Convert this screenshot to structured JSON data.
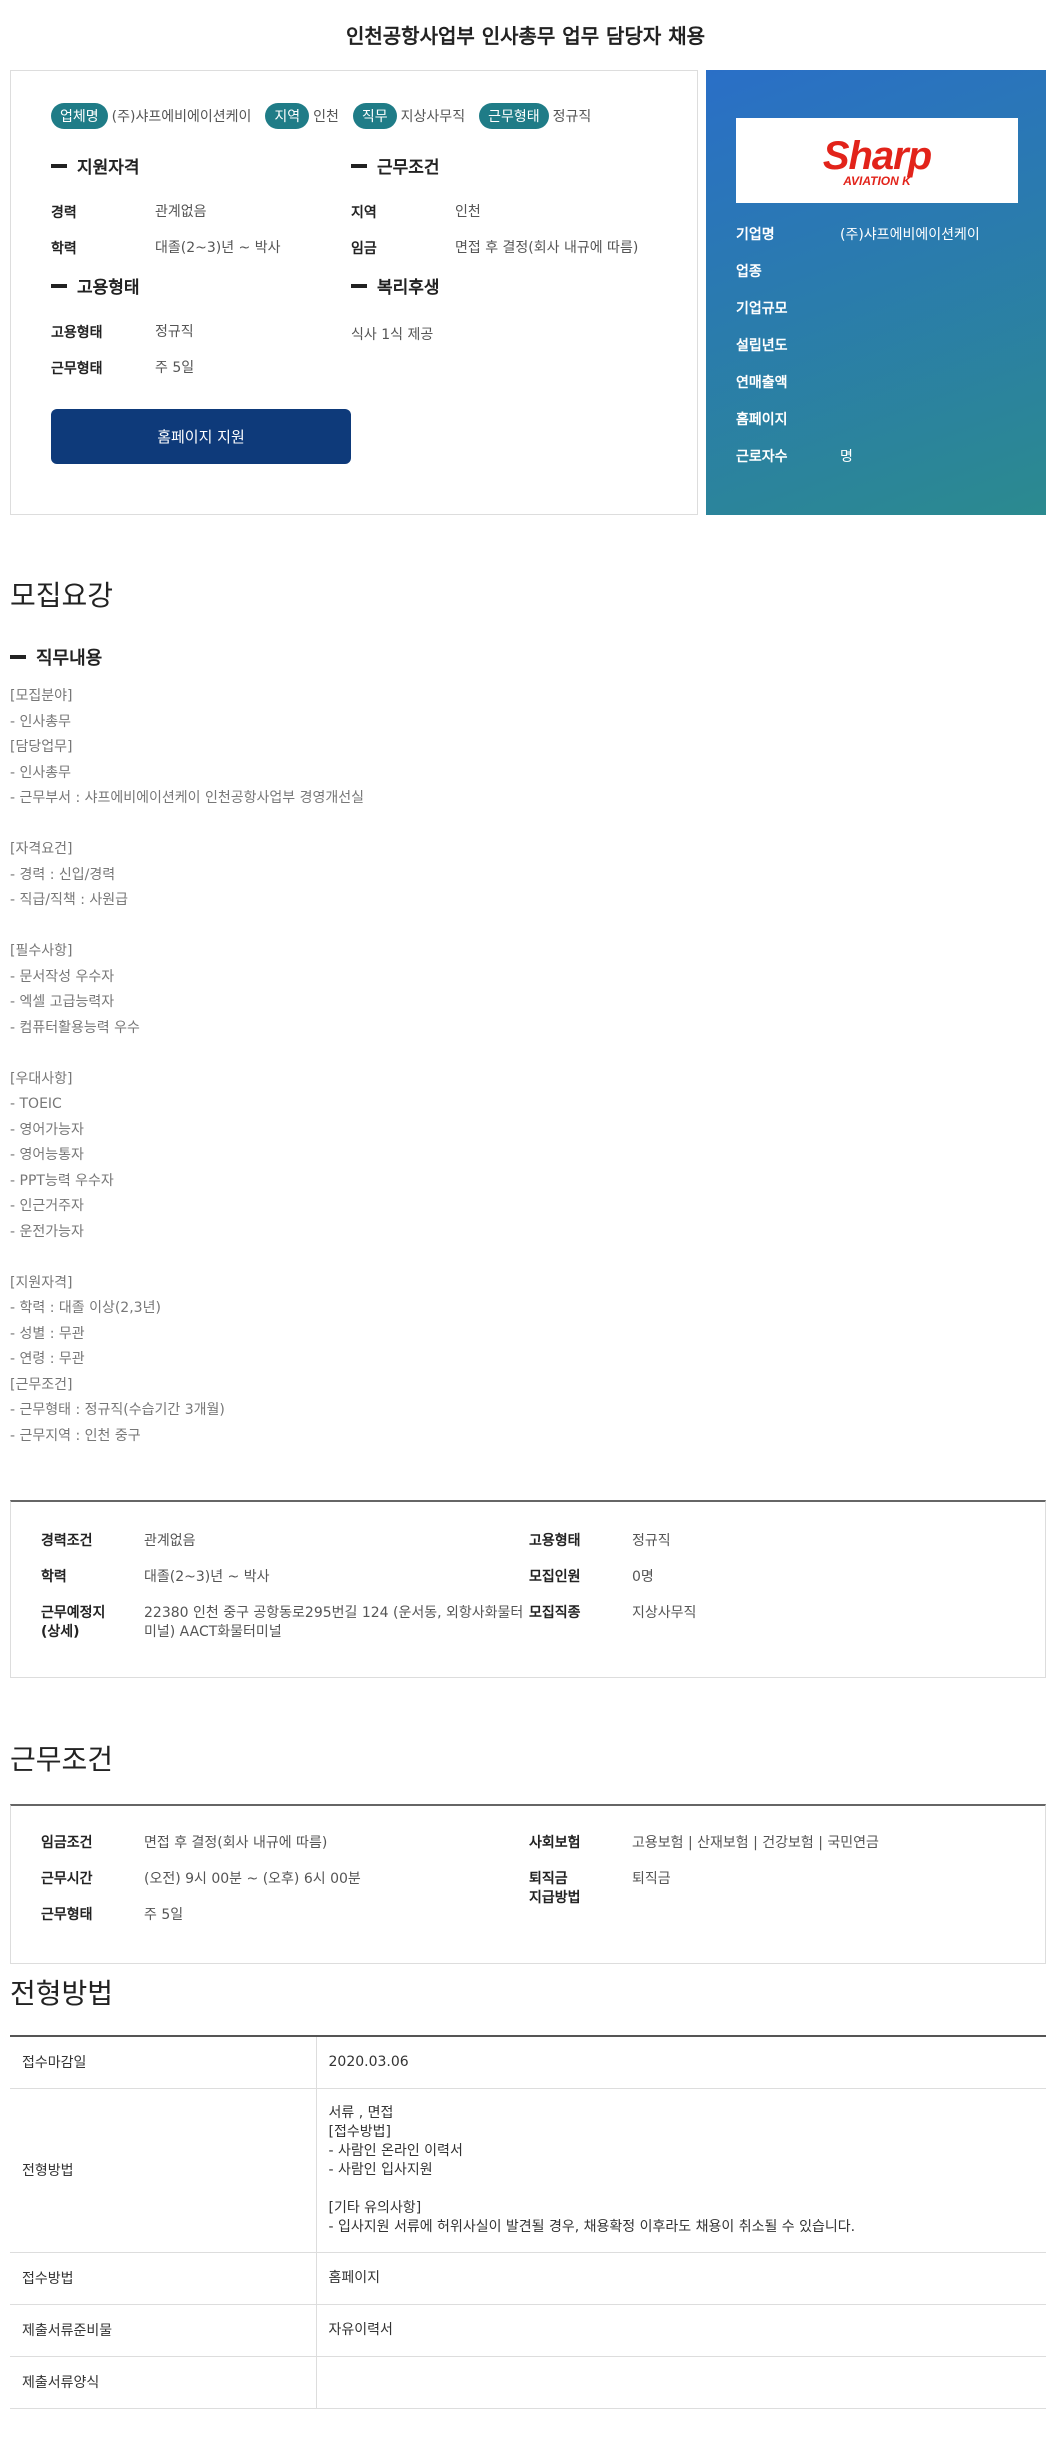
{
  "page_title": "인천공항사업부 인사총무 업무 담당자 채용",
  "tags": [
    {
      "label": "업체명",
      "value": "(주)샤프에비에이션케이"
    },
    {
      "label": "지역",
      "value": "인천"
    },
    {
      "label": "직무",
      "value": "지상사무직"
    },
    {
      "label": "근무형태",
      "value": "정규직"
    }
  ],
  "qualification": {
    "heading": "지원자격",
    "rows": [
      {
        "k": "경력",
        "v": "관계없음"
      },
      {
        "k": "학력",
        "v": "대졸(2~3)년 ~ 박사"
      }
    ]
  },
  "conditions": {
    "heading": "근무조건",
    "rows": [
      {
        "k": "지역",
        "v": "인천"
      },
      {
        "k": "임금",
        "v": "면접 후 결정(회사 내규에 따름)"
      }
    ]
  },
  "employment": {
    "heading": "고용형태",
    "rows": [
      {
        "k": "고용형태",
        "v": "정규직"
      },
      {
        "k": "근무형태",
        "v": "주 5일"
      }
    ]
  },
  "welfare": {
    "heading": "복리후생",
    "text": "식사 1식 제공"
  },
  "apply_button": "홈페이지 지원",
  "company": {
    "logo_text": "Sharp",
    "logo_sub": "AVIATION K",
    "rows": [
      {
        "k": "기업명",
        "v": "(주)샤프에비에이션케이"
      },
      {
        "k": "업종",
        "v": ""
      },
      {
        "k": "기업규모",
        "v": ""
      },
      {
        "k": "설립년도",
        "v": ""
      },
      {
        "k": "연매출액",
        "v": ""
      },
      {
        "k": "홈페이지",
        "v": ""
      },
      {
        "k": "근로자수",
        "v": "명"
      }
    ],
    "brand_color": "#e2231a"
  },
  "recruit": {
    "heading": "모집요강",
    "sub_heading": "직무내용",
    "lines": [
      "[모집분야]",
      "- 인사총무",
      "[담당업무]",
      "- 인사총무",
      "- 근무부서 : 샤프에비에이션케이 인천공항사업부 경영개선실",
      "",
      "[자격요건]",
      "- 경력 : 신입/경력",
      "- 직급/직책 : 사원급",
      "",
      "[필수사항]",
      "- 문서작성 우수자",
      "- 엑셀 고급능력자",
      "- 컴퓨터활용능력 우수",
      "",
      "[우대사항]",
      "- TOEIC",
      "- 영어가능자",
      "- 영어능통자",
      "- PPT능력 우수자",
      "- 인근거주자",
      "- 운전가능자",
      "",
      "[지원자격]",
      "- 학력 : 대졸 이상(2,3년)",
      "- 성별 : 무관",
      "- 연령 : 무관",
      "[근무조건]",
      "- 근무형태 : 정규직(수습기간 3개월)",
      "- 근무지역 : 인천 중구"
    ],
    "summary": [
      {
        "k": "경력조건",
        "v": "관계없음"
      },
      {
        "k": "학력",
        "v": "대졸(2~3)년 ~ 박사"
      },
      {
        "k": "근무예정지\n(상세)",
        "v": "22380 인천 중구 공항동로295번길 124 (운서동, 외항사화물터미널) AACT화물터미널"
      },
      {
        "k": "고용형태",
        "v": "정규직"
      },
      {
        "k": "모집인원",
        "v": "0명"
      },
      {
        "k": "모집직종",
        "v": "지상사무직"
      }
    ]
  },
  "work_conditions": {
    "heading": "근무조건",
    "rows": [
      {
        "k": "임금조건",
        "v": "면접 후 결정(회사 내규에 따름)"
      },
      {
        "k": "근무시간",
        "v": "(오전) 9시 00분 ~ (오후) 6시 00분"
      },
      {
        "k": "근무형태",
        "v": "주 5일"
      },
      {
        "k": "사회보험",
        "v": "고용보험 | 산재보험 | 건강보험 | 국민연금"
      },
      {
        "k": "퇴직금\n지급방법",
        "v": "퇴직금"
      }
    ]
  },
  "selection": {
    "heading": "전형방법",
    "rows": [
      {
        "k": "접수마감일",
        "v": "2020.03.06"
      },
      {
        "k": "전형방법",
        "v": "서류 , 면접\n[접수방법]\n- 사람인 온라인 이력서\n- 사람인 입사지원\n\n[기타 유의사항]\n- 입사지원 서류에 허위사실이 발견될 경우, 채용확정 이후라도 채용이 취소될 수 있습니다."
      },
      {
        "k": "접수방법",
        "v": "홈페이지"
      },
      {
        "k": "제출서류준비물",
        "v": "자유이력서"
      },
      {
        "k": "제출서류양식",
        "v": ""
      }
    ]
  }
}
